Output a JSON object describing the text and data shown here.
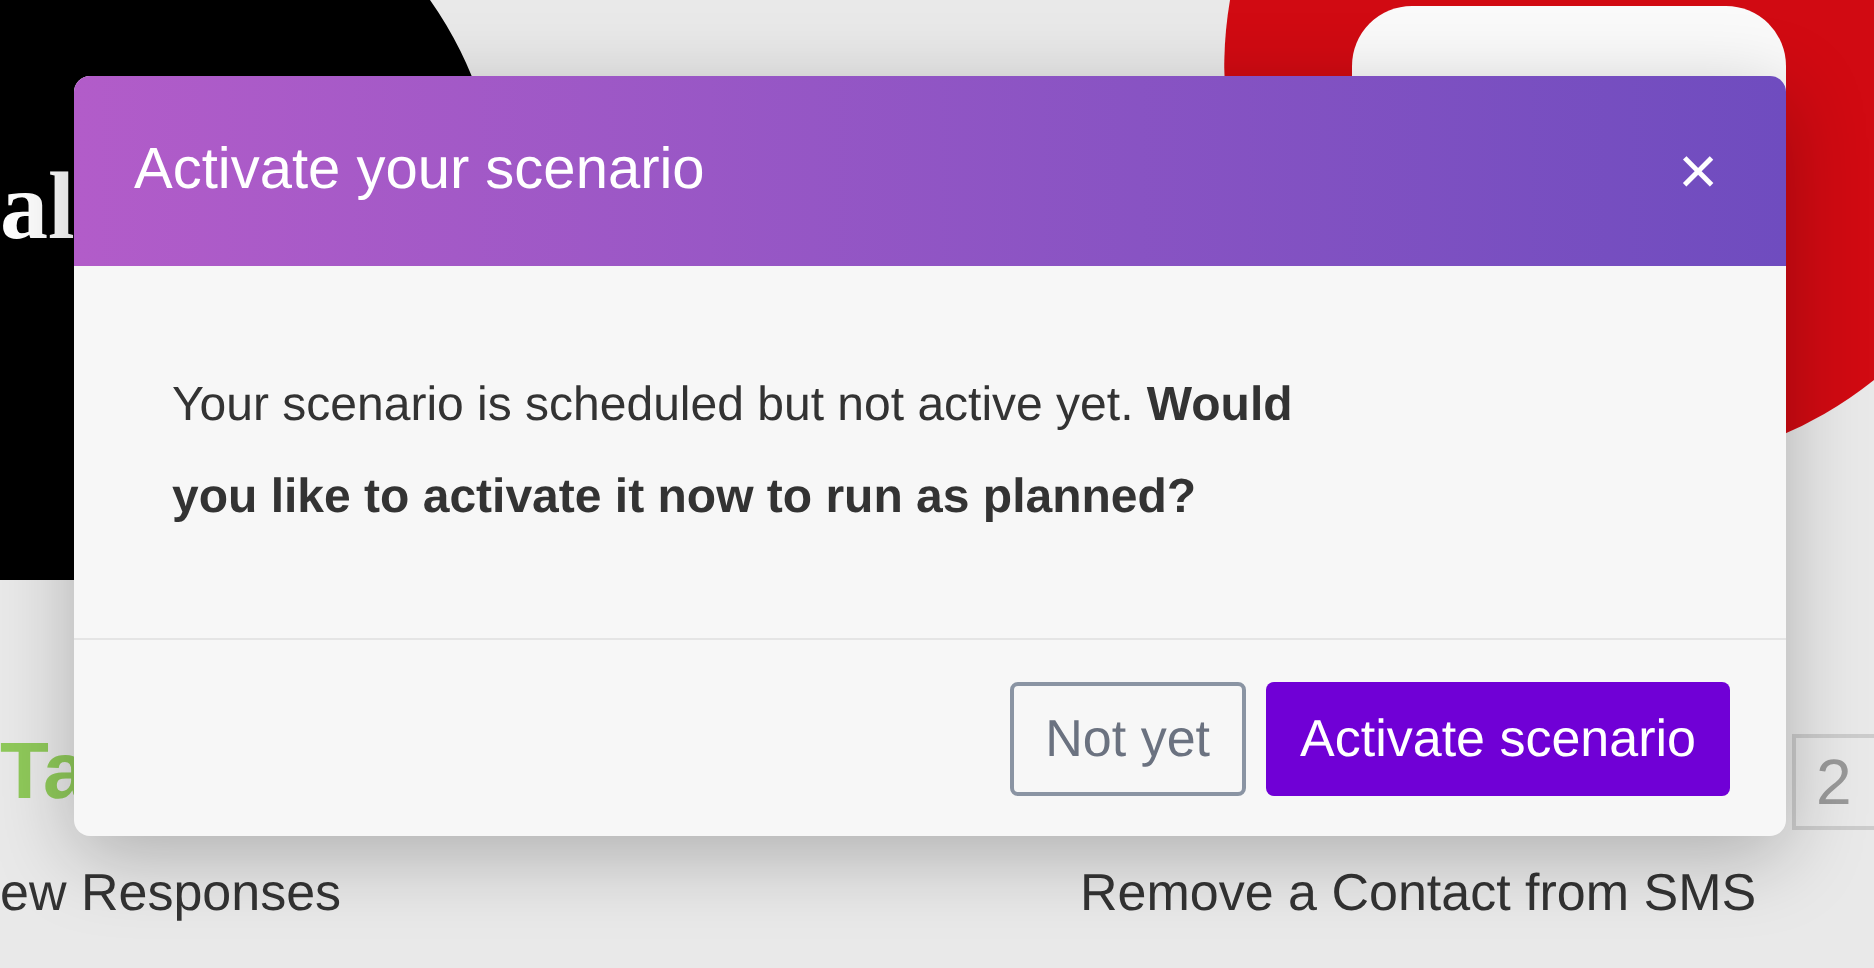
{
  "background": {
    "logo_text": "al",
    "app_name": "Ta",
    "cards": [
      {
        "title": "ew Responses"
      },
      {
        "title": "Remove a Contact from SMS"
      }
    ],
    "count": "2"
  },
  "dialog": {
    "title": "Activate your scenario",
    "close": "×",
    "message": "Your scenario is scheduled but not active yet. **Would you like to activate it now to run as planned?**",
    "buttons": [
      {
        "label": "Not yet",
        "kind": "secondary"
      },
      {
        "label": "Activate scenario",
        "kind": "primary"
      }
    ]
  }
}
